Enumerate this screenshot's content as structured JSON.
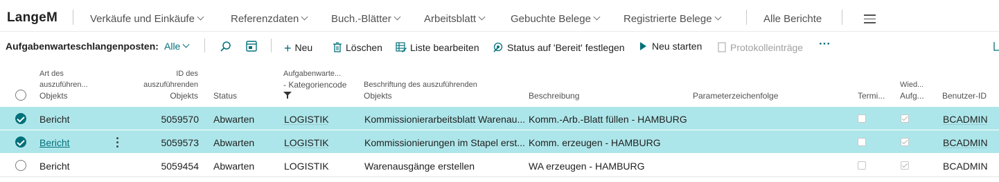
{
  "app": {
    "company": "LangeM"
  },
  "nav": {
    "items": [
      {
        "label": "Verkäufe und Einkäufe",
        "dropdown": true
      },
      {
        "label": "Referenzdaten",
        "dropdown": true
      },
      {
        "label": "Buch.-Blätter",
        "dropdown": true
      },
      {
        "label": "Arbeitsblatt",
        "dropdown": true
      },
      {
        "label": "Gebuchte Belege",
        "dropdown": true
      },
      {
        "label": "Registrierte Belege",
        "dropdown": true
      }
    ],
    "all_reports": "Alle Berichte",
    "menu_icon": "hamburger-icon"
  },
  "actionbar": {
    "title": "Aufgabenwarteschlangenposten:",
    "filter": "Alle",
    "search_icon": "search-icon",
    "layout_icon": "layout-icon",
    "new": "Neu",
    "delete": "Löschen",
    "edit_list": "Liste bearbeiten",
    "set_ready": "Status auf 'Bereit' festlegen",
    "restart": "Neu starten",
    "log_entries": "Protokolleinträge",
    "more": "···",
    "accent_color": "#00707a"
  },
  "grid": {
    "headers": {
      "object_type": [
        "Art des",
        "auszuführen...",
        "Objekts"
      ],
      "object_id": [
        "ID des",
        "auszuführenden",
        "Objekts"
      ],
      "status": [
        "Status"
      ],
      "category": [
        "Aufgabenwarte...",
        "- Kategoriencode"
      ],
      "caption": [
        "Beschriftung des auszuführenden",
        "Objekts"
      ],
      "description": [
        "Beschreibung"
      ],
      "parameter": [
        "Parameterzeichenfolge"
      ],
      "scheduled": [
        "Termi..."
      ],
      "recurring": [
        "Wied...",
        "Aufg..."
      ],
      "user": [
        "Benutzer-ID"
      ]
    },
    "rows": [
      {
        "selected": true,
        "object_type": "Bericht",
        "object_id": "5059570",
        "status": "Abwarten",
        "category": "LOGISTIK",
        "caption": "Kommissionierarbeitsblatt Warenau...",
        "description": "Komm.-Arb.-Blatt füllen - HAMBURG",
        "parameter": "",
        "scheduled": false,
        "recurring": true,
        "user": "BCADMIN"
      },
      {
        "selected": true,
        "object_type": "Bericht",
        "object_id": "5059573",
        "status": "Abwarten",
        "category": "LOGISTIK",
        "caption": "Kommissionierungen im Stapel erst...",
        "description": "Komm. erzeugen - HAMBURG",
        "parameter": "",
        "scheduled": false,
        "recurring": true,
        "user": "BCADMIN"
      },
      {
        "selected": false,
        "object_type": "Bericht",
        "object_id": "5059454",
        "status": "Abwarten",
        "category": "LOGISTIK",
        "caption": "Warenausgänge erstellen",
        "description": "WA erzeugen - HAMBURG",
        "parameter": "",
        "scheduled": false,
        "recurring": true,
        "user": "BCADMIN"
      }
    ],
    "selected_color": "#ade6ea"
  }
}
